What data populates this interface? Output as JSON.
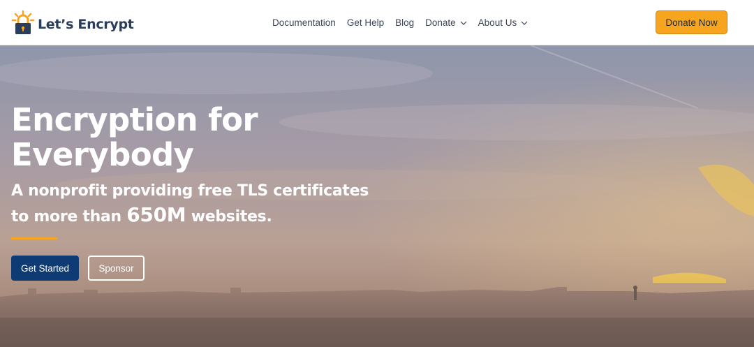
{
  "brand": {
    "name": "Let’s Encrypt",
    "logo_icon": "padlock-sun-icon",
    "colors": {
      "navy": "#2a3e5c",
      "orange": "#f7a51e",
      "button_blue": "#0e3b73"
    }
  },
  "nav": {
    "items": [
      {
        "label": "Documentation"
      },
      {
        "label": "Get Help"
      },
      {
        "label": "Blog"
      },
      {
        "label": "Donate",
        "icon": "chevron-down-icon"
      },
      {
        "label": "About Us",
        "icon": "chevron-down-icon"
      }
    ],
    "cta_label": "Donate Now"
  },
  "hero": {
    "title": "Encryption for Everybody",
    "subtitle_part1": "A nonprofit providing free TLS certificates to more than",
    "subtitle_number": "650M",
    "subtitle_part2": "websites.",
    "primary_button": "Get Started",
    "secondary_button": "Sponsor"
  }
}
